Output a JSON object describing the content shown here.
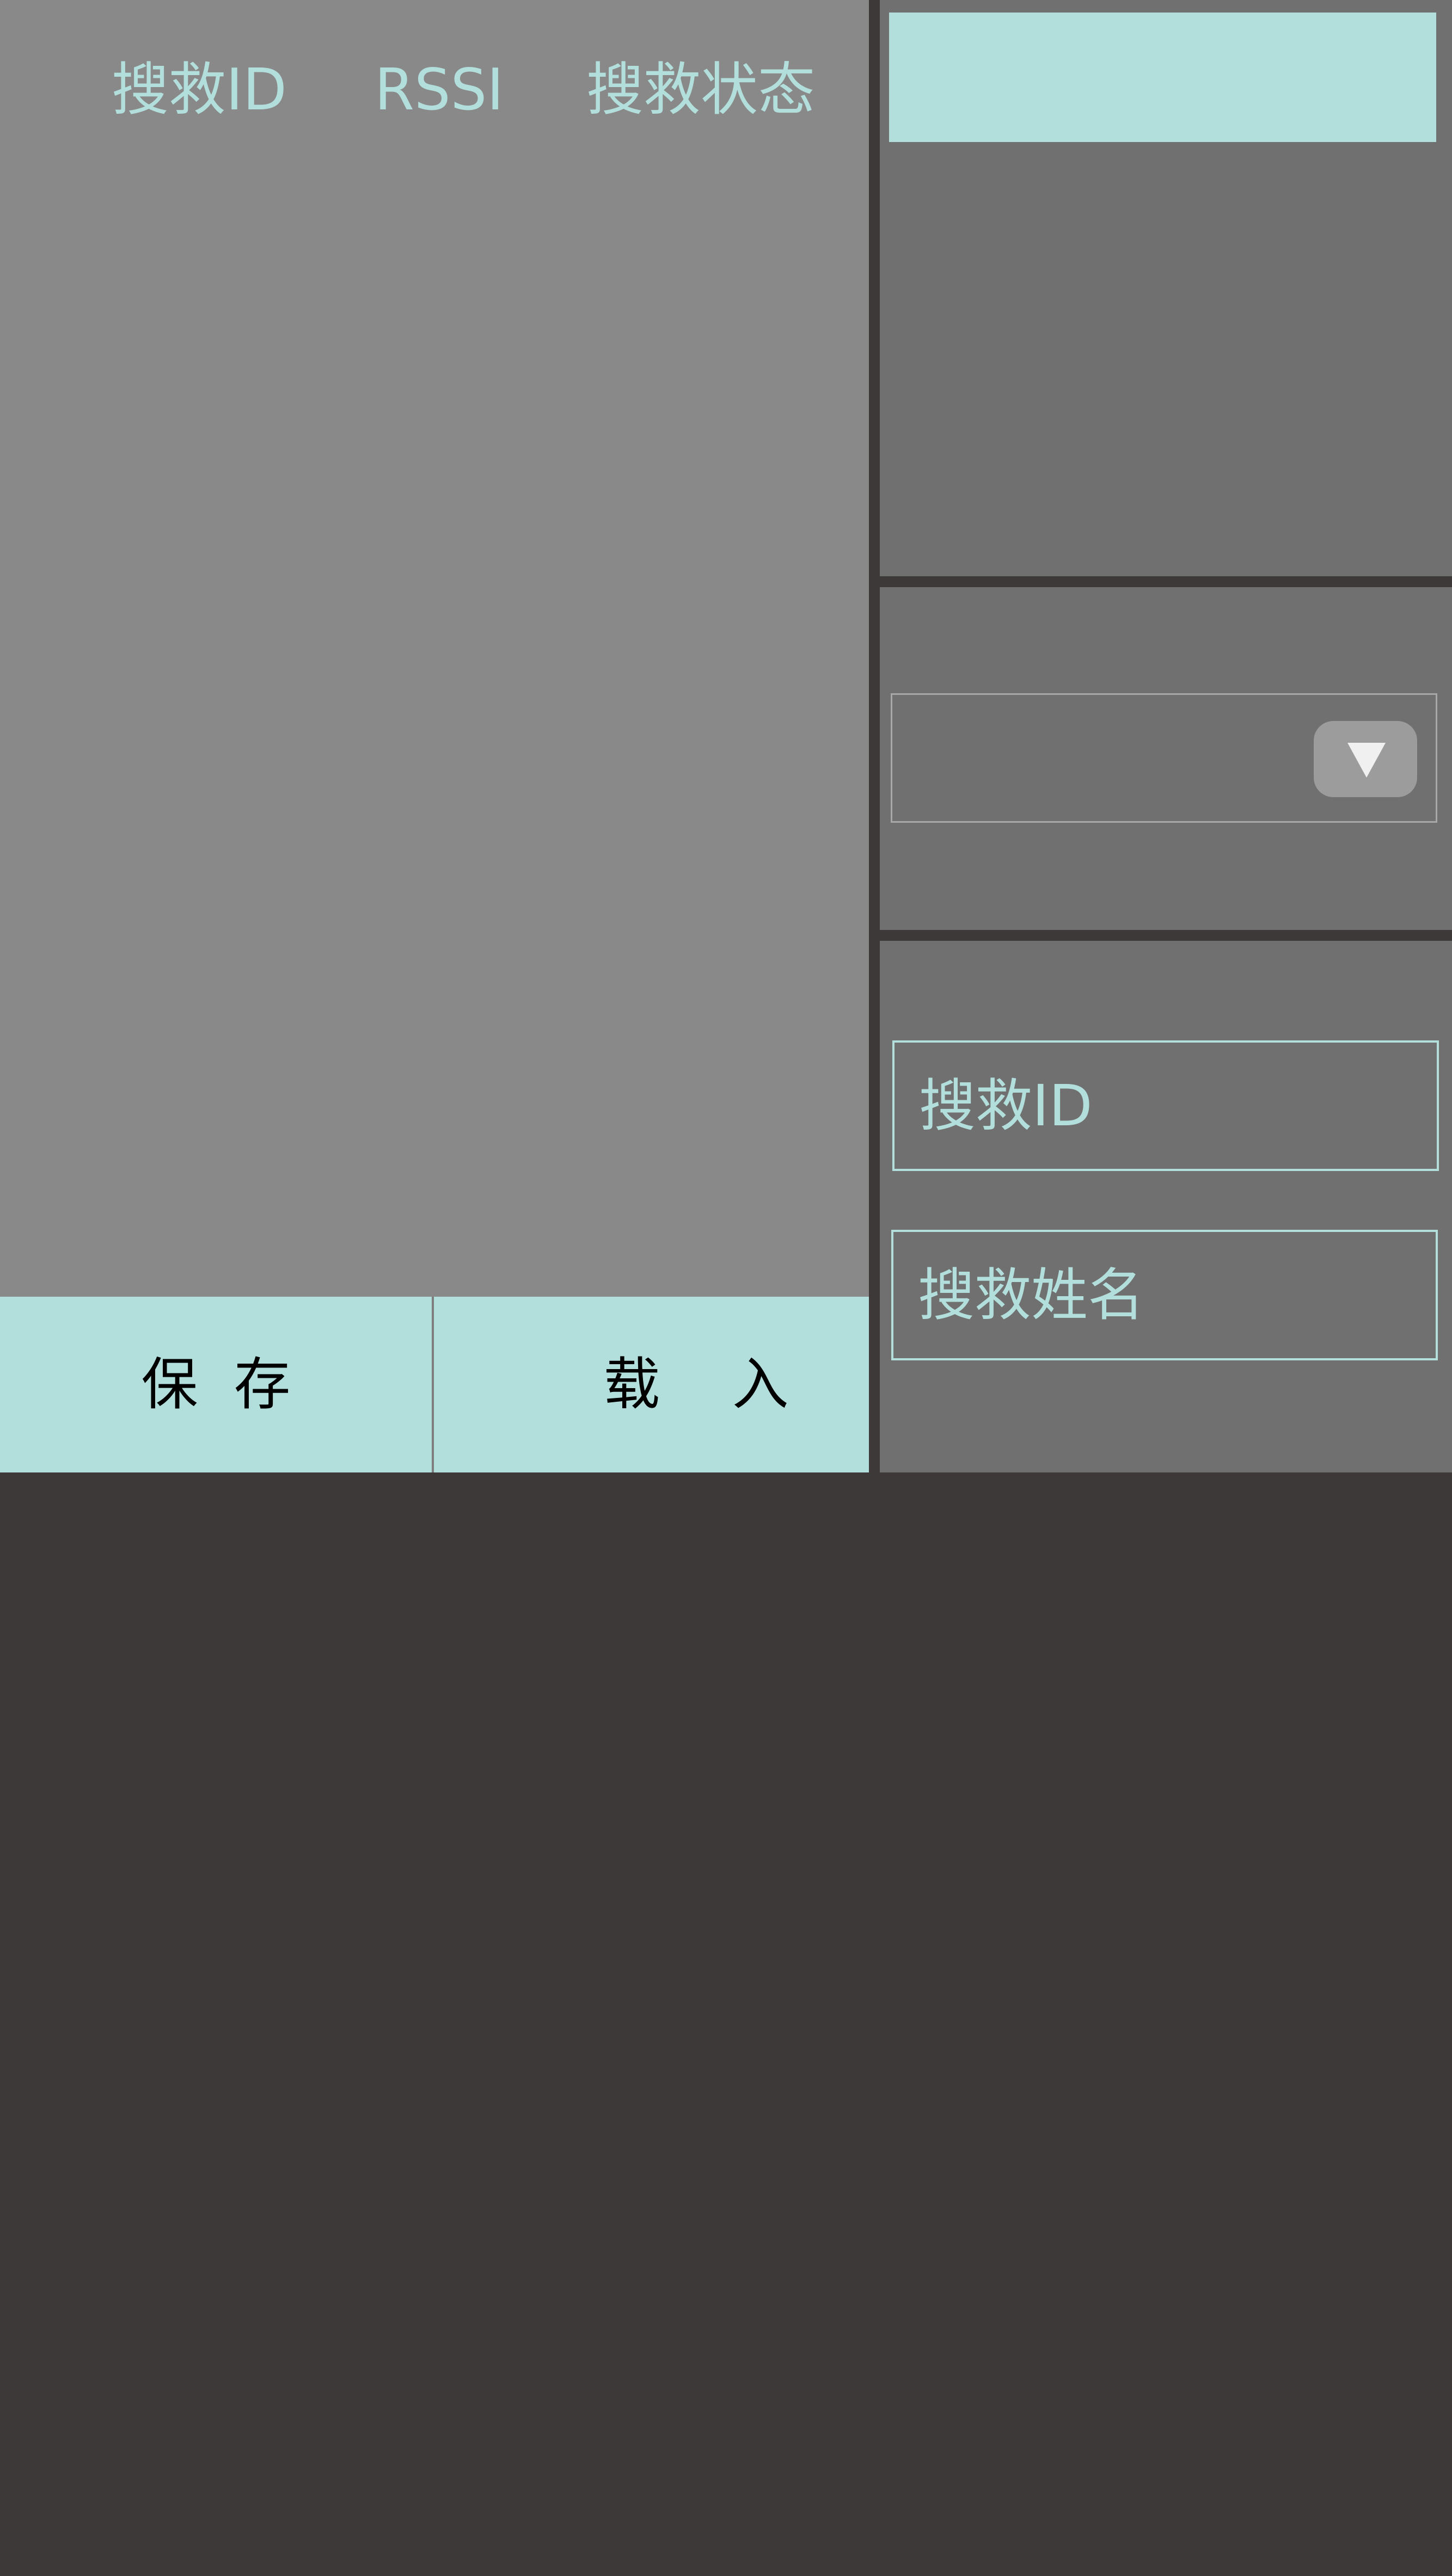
{
  "list": {
    "columns": {
      "rescue_id": "搜救ID",
      "rssi": "RSSI",
      "rescue_status": "搜救状态"
    },
    "rows": []
  },
  "buttons": {
    "save": "保  存",
    "load": "载    入"
  },
  "selector": {
    "selected_value": ""
  },
  "form": {
    "rescue_id_placeholder": "搜救ID",
    "rescue_name_placeholder": "搜救姓名"
  },
  "colors": {
    "accent": "#b2dedb",
    "panel_light": "#898989",
    "panel_dark": "#707070",
    "background": "#3d3938"
  },
  "icons": {
    "dropdown": "triangle-down-icon"
  }
}
